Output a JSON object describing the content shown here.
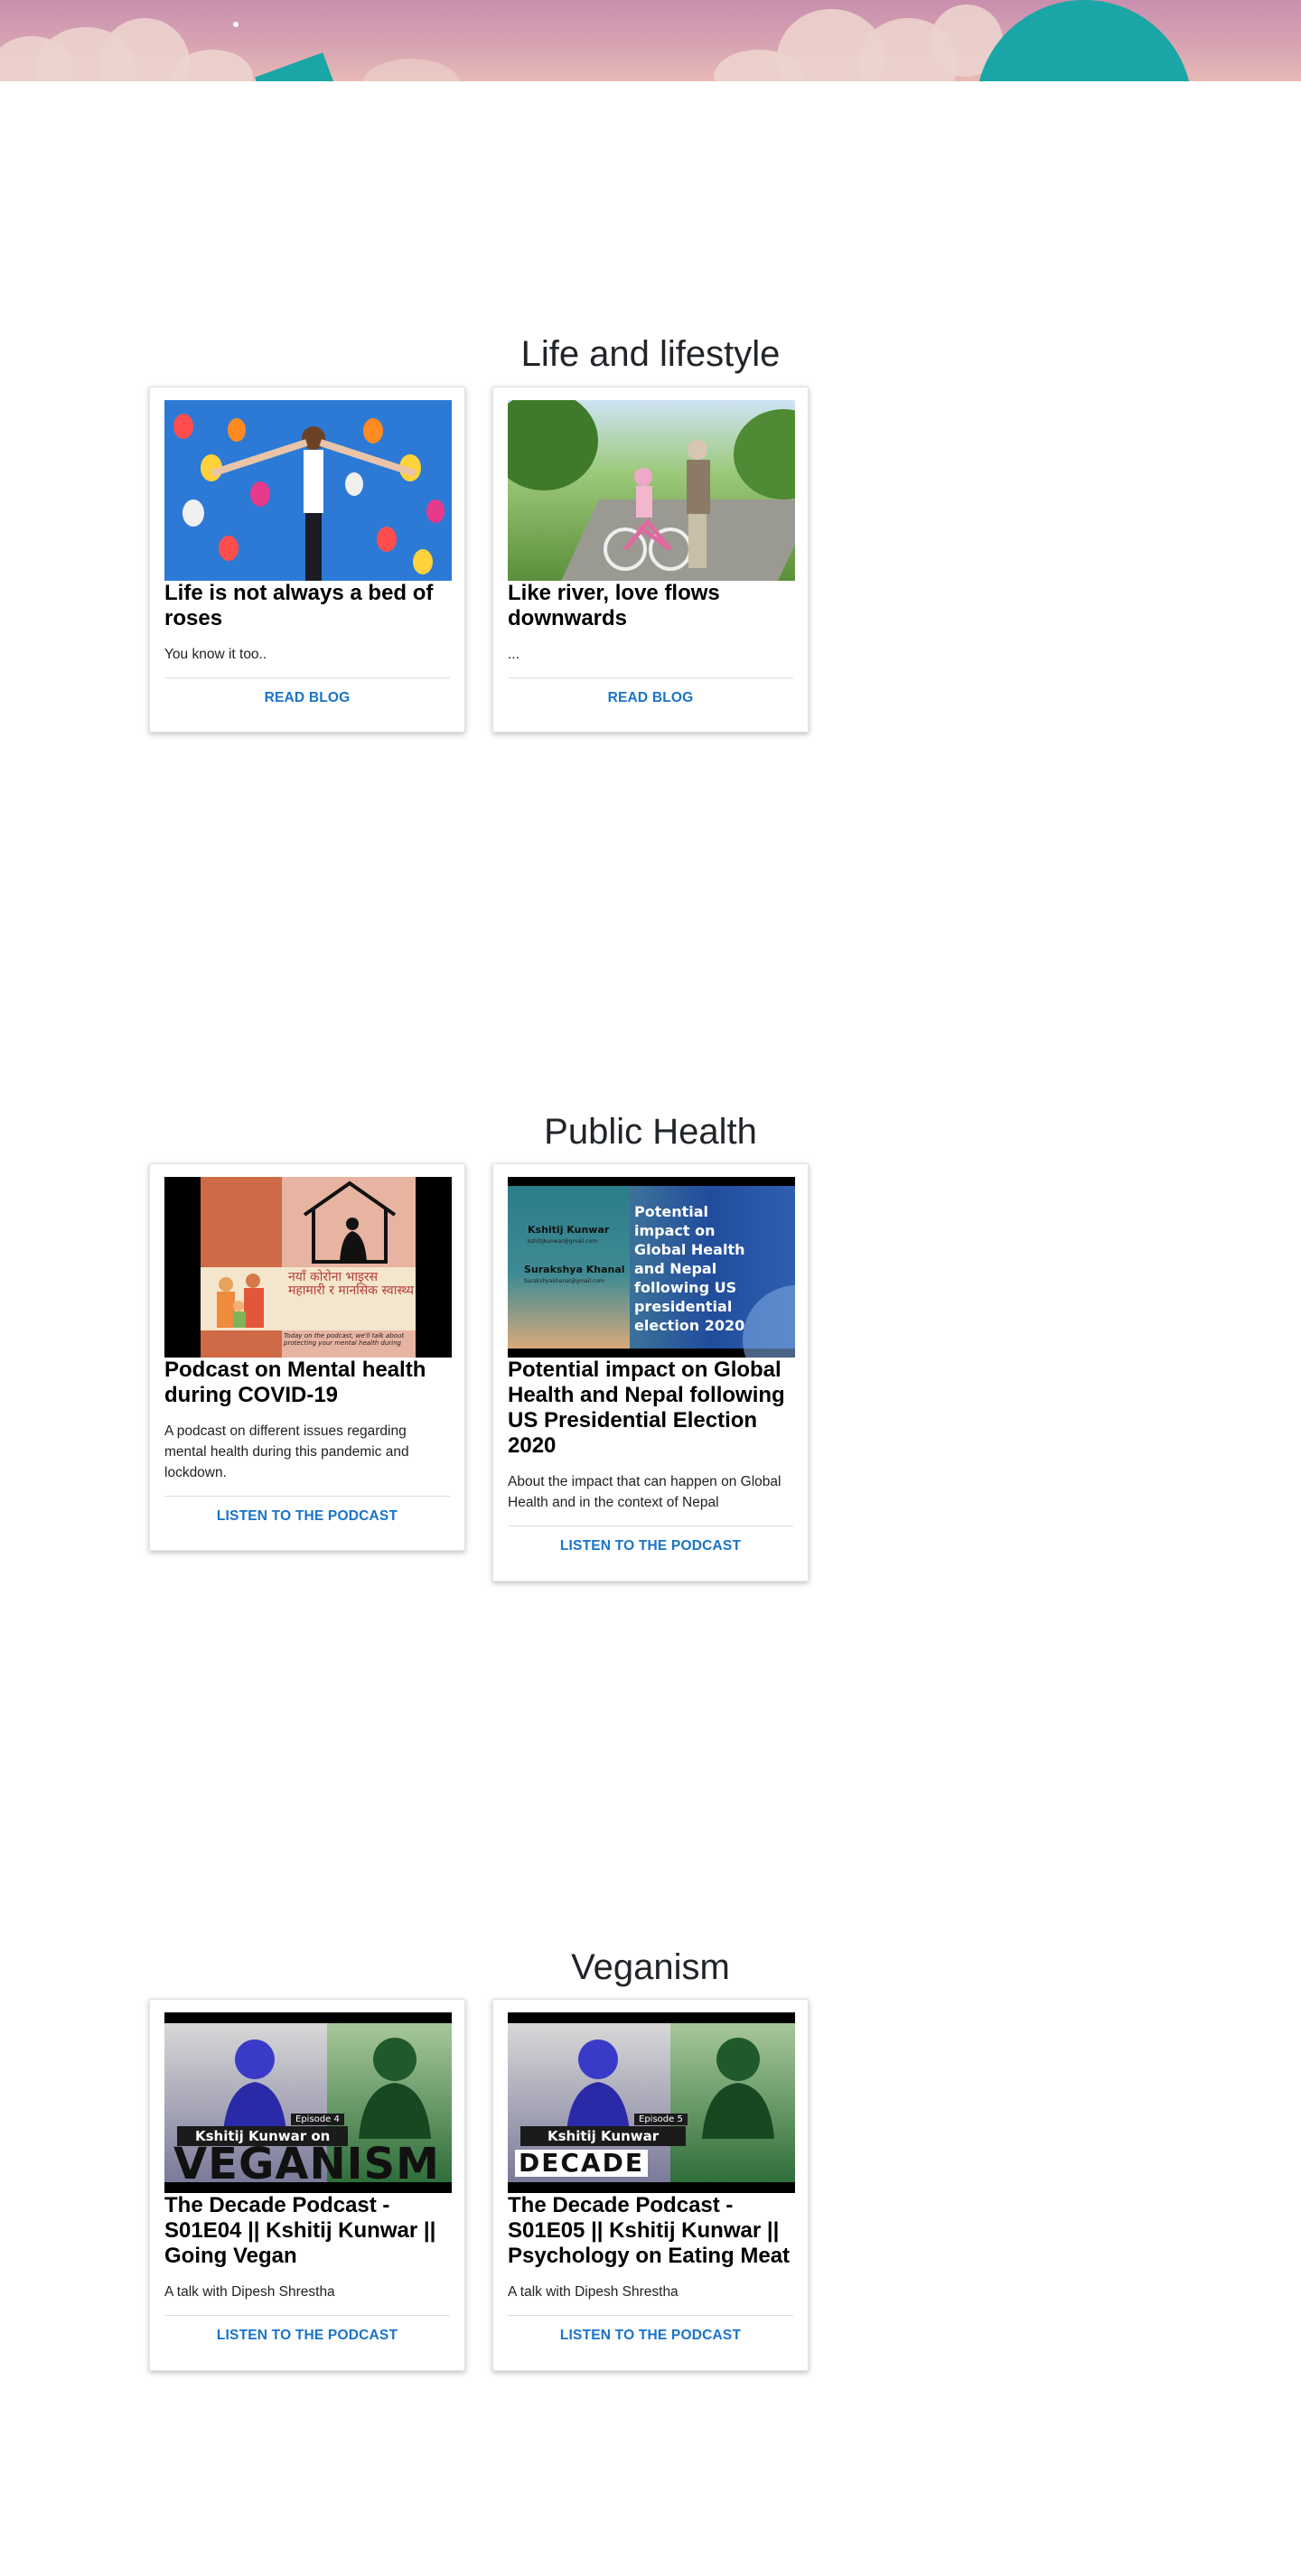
{
  "sections": [
    {
      "title": "Life and lifestyle",
      "cards": [
        {
          "title": "Life is not always a bed of roses",
          "description": "You know it too..",
          "cta": "READ BLOG",
          "thumb_icon": "balloons-photo"
        },
        {
          "title": "Like river, love flows downwards",
          "description": "...",
          "cta": "READ BLOG",
          "thumb_icon": "grandpa-bicycle-photo"
        }
      ]
    },
    {
      "title": "Public Health",
      "cards": [
        {
          "title": "Podcast on Mental health during COVID-19",
          "description": "A podcast on different issues regarding mental health during this pandemic and lockdown.",
          "cta": "LISTEN TO THE PODCAST",
          "thumb": {
            "nepali_text": "नयाँ कोरोना भाइरस महामारी र मानसिक स्वास्थ्य",
            "small_text": "Today on the podcast, we'll talk about protecting your mental health during"
          }
        },
        {
          "title": "Potential impact on Global Health and Nepal following US Presidential Election 2020",
          "description": "About the impact that can happen on Global Health and in the context of Nepal",
          "cta": "LISTEN TO THE PODCAST",
          "thumb": {
            "name1": "Kshitij Kunwar",
            "email1": "kshitijkunwar@gmail.com",
            "name2": "Surakshya Khanal",
            "email2": "Surakshyakhanal@gmail.com",
            "headline": "Potential impact on Global Health and Nepal following US presidential election 2020"
          }
        }
      ]
    },
    {
      "title": "Veganism",
      "cards": [
        {
          "title": "The Decade Podcast - S01E04 || Kshitij Kunwar || Going Vegan",
          "description": "A talk with Dipesh Shrestha",
          "cta": "LISTEN TO THE PODCAST",
          "thumb": {
            "episode": "Episode 4",
            "banner": "Kshitij Kunwar on",
            "big": "VEGANISM"
          }
        },
        {
          "title": "The Decade Podcast - S01E05 || Kshitij Kunwar || Psychology on Eating Meat",
          "description": "A talk with Dipesh Shrestha",
          "cta": "LISTEN TO THE PODCAST",
          "thumb": {
            "episode": "Episode 5",
            "banner": "Kshitij Kunwar",
            "big": "DECADE"
          }
        }
      ]
    }
  ],
  "colors": {
    "accent_link": "#1a73c8",
    "banner_pink": "#c88fae",
    "banner_teal": "#1aa6a6"
  }
}
